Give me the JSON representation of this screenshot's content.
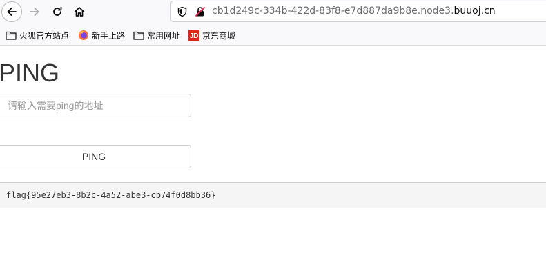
{
  "browser": {
    "url_prefix": "cb1d249c-334b-422d-83f8-e7d887da9b8e.node3.",
    "url_domain": "buuoj.cn",
    "bookmarks": [
      {
        "label": "火狐官方站点",
        "icon": "folder-icon"
      },
      {
        "label": "新手上路",
        "icon": "firefox-icon"
      },
      {
        "label": "常用网址",
        "icon": "folder-icon"
      },
      {
        "label": "京东商城",
        "icon": "jd-logo-icon"
      }
    ]
  },
  "page": {
    "title": "PING",
    "input_placeholder": "请输入需要ping的地址",
    "input_value": "",
    "button_label": "PING",
    "output_text": "flag{95e27eb3-8b2c-4a52-abe3-cb74f0d8bb36}"
  }
}
